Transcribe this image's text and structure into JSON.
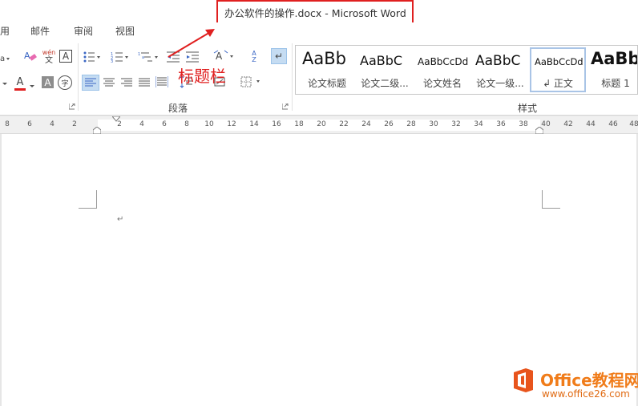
{
  "window": {
    "title": "办公软件的操作.docx - Microsoft Word"
  },
  "tabs": [
    {
      "label": "用"
    },
    {
      "label": "邮件"
    },
    {
      "label": "审阅"
    },
    {
      "label": "视图"
    }
  ],
  "ribbon": {
    "font_partial": {
      "row1": [
        "font-size-dropdown",
        "eraser-clear-format-icon",
        "phonetic-guide-icon",
        "character-border-icon"
      ],
      "row2": [
        "highlight-dropdown",
        "font-color-icon",
        "character-shading-icon",
        "enclose-characters-icon"
      ],
      "phonetic_text": "wén",
      "phonetic_sub": "文",
      "border_char": "A",
      "font_color_char": "A",
      "shading_char": "A",
      "enclose_char": "字"
    },
    "paragraph": {
      "group_label": "段落"
    },
    "styles": {
      "group_label": "样式",
      "items": [
        {
          "preview": "AaBb",
          "name": "论文标题"
        },
        {
          "preview": "AaBbC",
          "name": "论文二级..."
        },
        {
          "preview": "AaBbCcDd",
          "name": "论文姓名"
        },
        {
          "preview": "AaBbC",
          "name": "论文一级..."
        },
        {
          "preview": "AaBbCcDd",
          "name": "↲ 正文"
        },
        {
          "preview": "AaBb",
          "name": "标题 1"
        }
      ]
    },
    "sort_char": "A",
    "sort_char2": "Z"
  },
  "annotation": {
    "text": "标题栏",
    "color": "#e02020"
  },
  "ruler": {
    "left_ticks": [
      "8",
      "6",
      "4",
      "2"
    ],
    "right_ticks": [
      "2",
      "4",
      "6",
      "8",
      "10",
      "12",
      "14",
      "16",
      "18",
      "20",
      "22",
      "24",
      "26",
      "28",
      "30",
      "32",
      "34",
      "36",
      "38",
      "40",
      "42",
      "44",
      "46",
      "48"
    ]
  },
  "document": {
    "paragraph_mark": "↵"
  },
  "watermark": {
    "brand": "Office教程网",
    "url": "www.office26.com"
  }
}
